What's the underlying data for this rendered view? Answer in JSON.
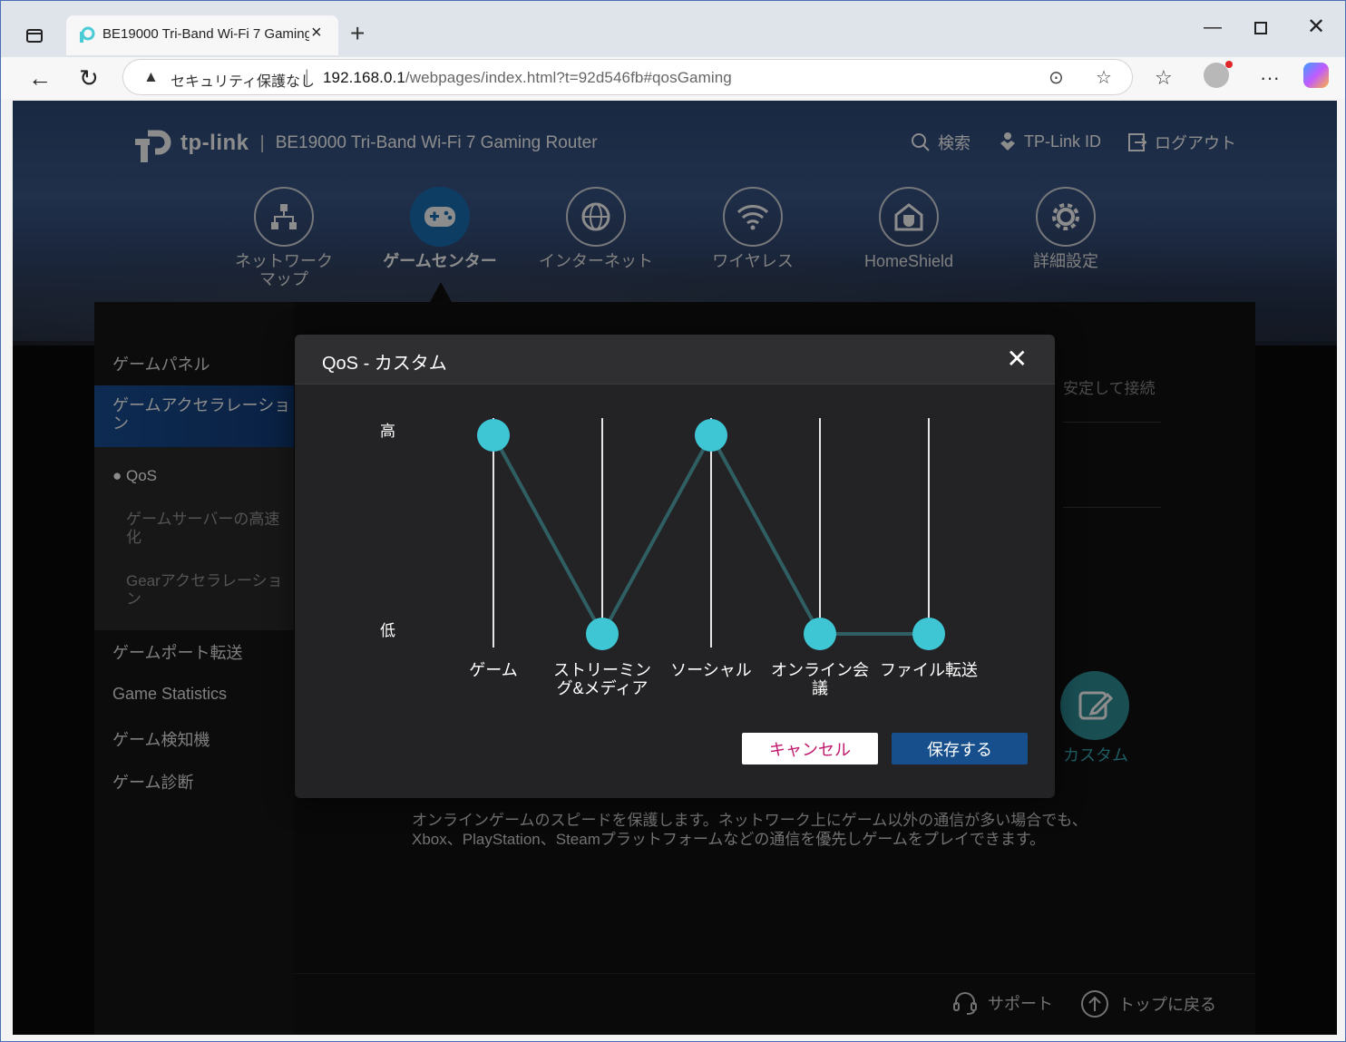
{
  "browser": {
    "tab_title": "BE19000 Tri-Band Wi-Fi 7 Gaming",
    "security_label": "セキュリティ保護なし",
    "url_host": "192.168.0.1",
    "url_path": "/webpages/index.html?t=92d546fb#qosGaming"
  },
  "header": {
    "logo_text": "tp-link",
    "model": "BE19000 Tri-Band Wi-Fi 7 Gaming Router",
    "search_label": "検索",
    "tplink_id_label": "TP-Link ID",
    "logout_label": "ログアウト"
  },
  "nav": [
    {
      "label": "ネットワーク\nマップ",
      "icon": "network-map-icon"
    },
    {
      "label": "ゲームセンター",
      "icon": "gamepad-icon",
      "active": true
    },
    {
      "label": "インターネット",
      "icon": "globe-icon"
    },
    {
      "label": "ワイヤレス",
      "icon": "wifi-icon"
    },
    {
      "label": "HomeShield",
      "icon": "home-shield-icon"
    },
    {
      "label": "詳細設定",
      "icon": "gear-icon"
    }
  ],
  "sidebar": {
    "items": [
      "ゲームパネル",
      "ゲームアクセラレーション",
      "ゲームポート転送",
      "Game Statistics",
      "ゲーム検知機",
      "ゲーム診断"
    ],
    "sub": [
      "QoS",
      "ゲームサーバーの高速化",
      "Gearアクセラレーション"
    ]
  },
  "main": {
    "partial_text": "安定して接続",
    "custom_label": "カスタム",
    "description_line1": "オンラインゲームのスピードを保護します。ネットワーク上にゲーム以外の通信が多い場合でも、",
    "description_line2": "Xbox、PlayStation、Steamプラットフォームなどの通信を優先しゲームをプレイできます。"
  },
  "footer": {
    "support_label": "サポート",
    "top_label": "トップに戻る"
  },
  "modal": {
    "title": "QoS - カスタム",
    "close": "✕",
    "high_label": "高",
    "low_label": "低",
    "cancel_label": "キャンセル",
    "save_label": "保存する"
  },
  "chart_data": {
    "type": "line",
    "categories": [
      "ゲーム",
      "ストリーミング&メディア",
      "ソーシャル",
      "オンライン会議",
      "ファイル転送"
    ],
    "y_levels": [
      "低",
      "高"
    ],
    "values": [
      "高",
      "低",
      "高",
      "低",
      "低"
    ],
    "color": "#3fc6d4",
    "line_color": "#2f5f63"
  },
  "colors": {
    "accent_blue": "#1b6fb6",
    "teal": "#3fc6d4",
    "cancel_text": "#c0186e"
  }
}
